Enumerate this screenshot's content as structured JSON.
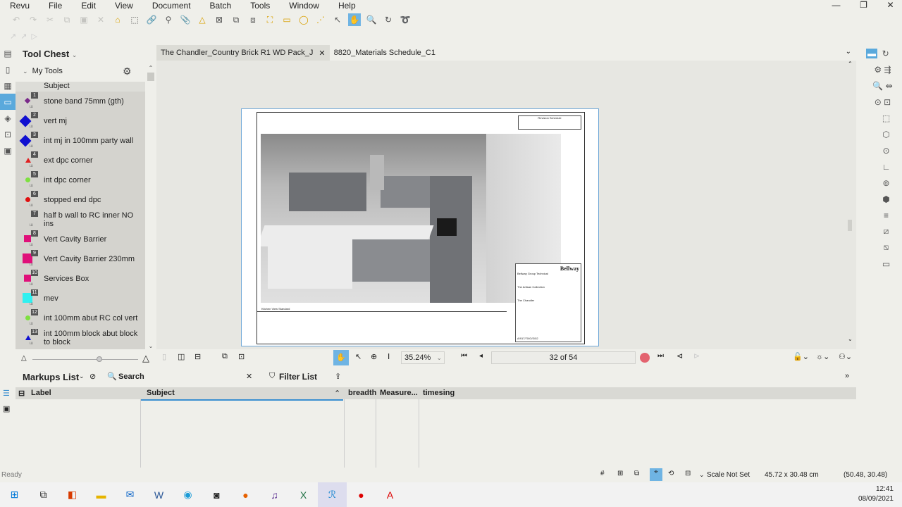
{
  "menu": [
    "Revu",
    "File",
    "Edit",
    "View",
    "Document",
    "Batch",
    "Tools",
    "Window",
    "Help"
  ],
  "tool_chest": {
    "title": "Tool Chest",
    "section": "My Tools",
    "column": "Subject",
    "items": [
      {
        "num": "1",
        "label": "stone band 75mm (gth)",
        "color": "#7a2a8a",
        "shape": "diamond-small"
      },
      {
        "num": "2",
        "label": "vert mj",
        "color": "#1010d0",
        "shape": "diamond"
      },
      {
        "num": "3",
        "label": "int mj in 100mm party wall",
        "color": "#1010d0",
        "shape": "diamond"
      },
      {
        "num": "4",
        "label": "ext dpc corner",
        "color": "#e02020",
        "shape": "triangle"
      },
      {
        "num": "5",
        "label": "int dpc corner",
        "color": "#7ee040",
        "shape": "dot"
      },
      {
        "num": "6",
        "label": "stopped end dpc",
        "color": "#e01010",
        "shape": "dot"
      },
      {
        "num": "7",
        "label": "half b wall to RC inner NO ins",
        "color": "#888888",
        "shape": "none"
      },
      {
        "num": "8",
        "label": "Vert Cavity Barrier",
        "color": "#e0107a",
        "shape": "square"
      },
      {
        "num": "9",
        "label": "Vert Cavity Barrier 230mm",
        "color": "#e0107a",
        "shape": "square-big"
      },
      {
        "num": "10",
        "label": "Services Box",
        "color": "#e0107a",
        "shape": "square"
      },
      {
        "num": "11",
        "label": "mev",
        "color": "#30f0f0",
        "shape": "square-big"
      },
      {
        "num": "12",
        "label": "int 100mm  abut RC col vert",
        "color": "#7ee040",
        "shape": "dot"
      },
      {
        "num": "13",
        "label": "int 100mm block abut block to block",
        "color": "#1010d0",
        "shape": "triangle"
      }
    ]
  },
  "tabs": [
    {
      "label": "The Chandler_Country Brick R1 WD Pack_J",
      "active": true
    },
    {
      "label": "8820_Materials Schedule_C1",
      "active": false
    }
  ],
  "sheet": {
    "caption": "Kitchen View Standard",
    "brand": "Bellway",
    "client": "Bellway Group Technical",
    "collection": "The Artisan Collection",
    "house": "The Chandler",
    "drawing_no": "A/917/70/G/S/02",
    "schedule": "Revision Schedule"
  },
  "nav": {
    "zoom": "35.24%",
    "page": "32 of 54"
  },
  "markups": {
    "title": "Markups List",
    "search": "Search",
    "filter": "Filter List",
    "columns": [
      "Label",
      "Subject",
      "breadth",
      "Measure...",
      "timesing"
    ]
  },
  "status": {
    "left": "Ready",
    "scale": "Scale Not Set",
    "size": "45.72 x 30.48 cm",
    "coords": "(50.48, 30.48)"
  },
  "clock": {
    "time": "12:41",
    "date": "08/09/2021"
  },
  "accent": "#5aa9dc"
}
